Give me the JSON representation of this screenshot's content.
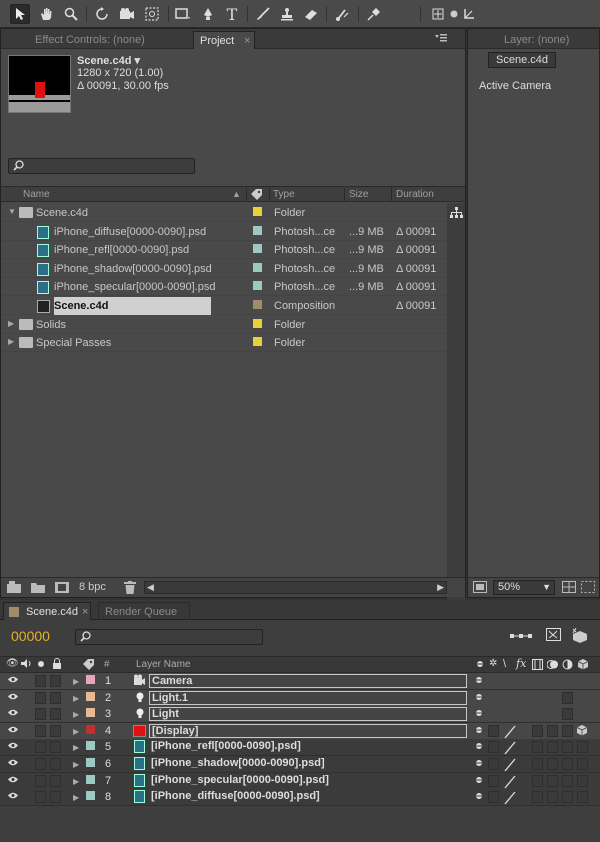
{
  "toolbar": {
    "tools": [
      "selection-tool",
      "hand-tool",
      "zoom-tool",
      "rotation-tool",
      "camera-tool",
      "pan-behind-tool",
      "rectangle-tool",
      "pen-tool",
      "type-tool",
      "brush-tool",
      "clone-stamp-tool",
      "eraser-tool",
      "roto-brush-tool",
      "puppet-pin-tool",
      "axis-local",
      "axis-world",
      "axis-view"
    ],
    "type_glyph": "T"
  },
  "project_panel": {
    "tabs": [
      {
        "label": "Effect Controls: (none)"
      },
      {
        "label": "Project"
      }
    ],
    "close_glyph": "×",
    "preview": {
      "name": "Scene.c4d ▾",
      "resolution": "1280 x 720 (1.00)",
      "duration": "Δ 00091, 30.00 fps"
    },
    "columns": {
      "name": "Name",
      "type": "Type",
      "size": "Size",
      "duration": "Duration"
    },
    "rows": [
      {
        "name": "Scene.c4d",
        "type": "Folder",
        "size": "",
        "duration": "",
        "color": "#e8d23a",
        "kind": "folder",
        "indent": 0
      },
      {
        "name": "iPhone_diffuse[0000-0090].psd",
        "type": "Photosh...ce",
        "size": "...9 MB",
        "duration": "Δ 00091",
        "color": "#9cc9c2",
        "kind": "psd",
        "indent": 1
      },
      {
        "name": "iPhone_refl[0000-0090].psd",
        "type": "Photosh...ce",
        "size": "...9 MB",
        "duration": "Δ 00091",
        "color": "#9cc9c2",
        "kind": "psd",
        "indent": 1
      },
      {
        "name": "iPhone_shadow[0000-0090].psd",
        "type": "Photosh...ce",
        "size": "...9 MB",
        "duration": "Δ 00091",
        "color": "#9cc9c2",
        "kind": "psd",
        "indent": 1
      },
      {
        "name": "iPhone_specular[0000-0090].psd",
        "type": "Photosh...ce",
        "size": "...9 MB",
        "duration": "Δ 00091",
        "color": "#9cc9c2",
        "kind": "psd",
        "indent": 1
      },
      {
        "name": "Scene.c4d",
        "type": "Composition",
        "size": "",
        "duration": "Δ 00091",
        "color": "#a08c6c",
        "kind": "comp",
        "indent": 1,
        "selected": true
      },
      {
        "name": "Solids",
        "type": "Folder",
        "size": "",
        "duration": "",
        "color": "#e8d23a",
        "kind": "folder",
        "indent": 0
      },
      {
        "name": "Special Passes",
        "type": "Folder",
        "size": "",
        "duration": "",
        "color": "#e8d23a",
        "kind": "folder",
        "indent": 0
      }
    ],
    "footer": {
      "bpc": "8 bpc"
    }
  },
  "layer_panel": {
    "tab": "Layer: (none)",
    "comp_button": "Scene.c4d",
    "camera_label": "Active Camera",
    "zoom": "50%"
  },
  "timeline": {
    "tabs": [
      {
        "label": "Scene.c4d"
      },
      {
        "label": "Render Queue"
      }
    ],
    "timecode": "00000",
    "col_hash": "#",
    "col_layer_name": "Layer Name",
    "layers": [
      {
        "num": "1",
        "name": "Camera",
        "color": "#e6a6b8",
        "kind": "camera",
        "boxed": true
      },
      {
        "num": "2",
        "name": "Light.1",
        "color": "#e8b896",
        "kind": "light",
        "boxed": true
      },
      {
        "num": "3",
        "name": "Light",
        "color": "#e8b896",
        "kind": "light",
        "boxed": true
      },
      {
        "num": "4",
        "name": "[Display]",
        "color": "#c03030",
        "kind": "solid",
        "boxed": true
      },
      {
        "num": "5",
        "name": "[iPhone_refl[0000-0090].psd]",
        "color": "#9cc9c2",
        "kind": "psd",
        "boxed": false
      },
      {
        "num": "6",
        "name": "[iPhone_shadow[0000-0090].psd]",
        "color": "#9cc9c2",
        "kind": "psd",
        "boxed": false
      },
      {
        "num": "7",
        "name": "[iPhone_specular[0000-0090].psd]",
        "color": "#9cc9c2",
        "kind": "psd",
        "boxed": false
      },
      {
        "num": "8",
        "name": "[iPhone_diffuse[0000-0090].psd]",
        "color": "#9cc9c2",
        "kind": "psd",
        "boxed": false
      }
    ]
  }
}
